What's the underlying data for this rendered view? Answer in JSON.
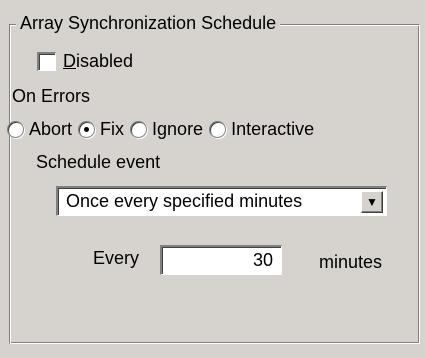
{
  "group": {
    "title": "Array Synchronization Schedule"
  },
  "disabled_checkbox": {
    "label": "Disabled",
    "checked": false
  },
  "on_errors": {
    "label": "On Errors",
    "options": [
      {
        "label": "Abort",
        "selected": false
      },
      {
        "label": "Fix",
        "selected": true
      },
      {
        "label": "Ignore",
        "selected": false
      },
      {
        "label": "Interactive",
        "selected": false
      }
    ]
  },
  "schedule": {
    "label": "Schedule event",
    "selected_value": "Once every specified minutes",
    "dropdown_icon": "triangle-down-icon"
  },
  "every": {
    "label": "Every",
    "value": "30",
    "unit": "minutes"
  },
  "colors": {
    "window_bg": "#d6d3ce",
    "field_bg": "#ffffff",
    "text": "#000000"
  }
}
